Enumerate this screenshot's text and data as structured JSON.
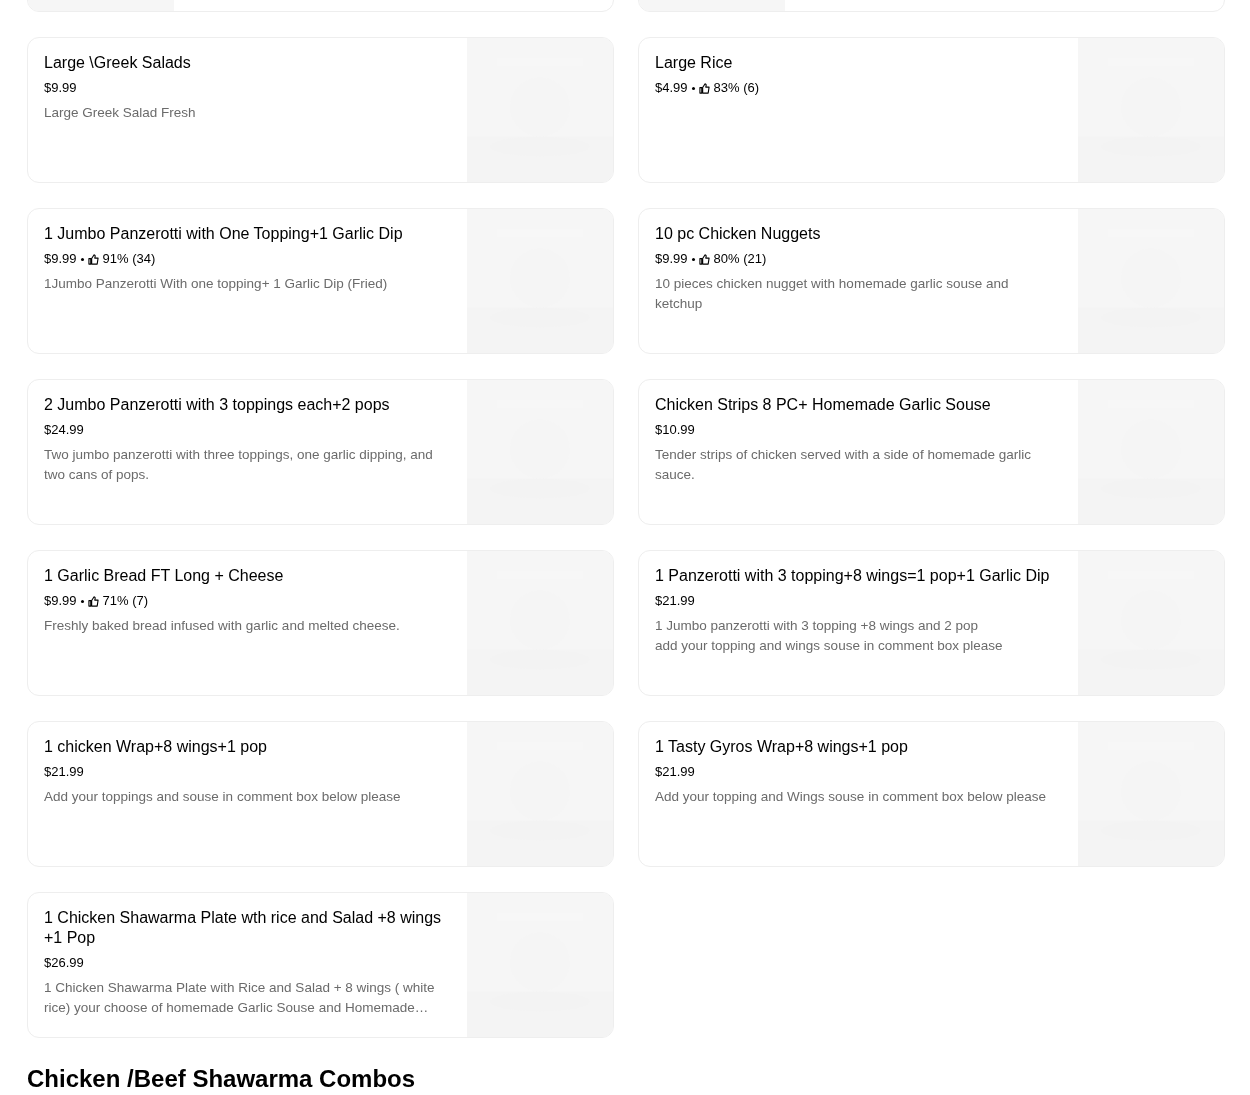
{
  "items": [
    {
      "title": "Large \\Greek Salads",
      "price": "$9.99",
      "description": "Large Greek Salad Fresh"
    },
    {
      "title": "Large Rice",
      "price": "$4.99",
      "rating": "83% (6)"
    },
    {
      "title": "1 Jumbo Panzerotti with One Topping+1 Garlic Dip",
      "price": "$9.99",
      "rating": "91% (34)",
      "description": "1Jumbo Panzerotti With one topping+ 1 Garlic Dip (Fried)"
    },
    {
      "title": "10 pc Chicken Nuggets",
      "price": "$9.99",
      "rating": "80% (21)",
      "description": "10 pieces chicken nugget with homemade garlic souse and ketchup"
    },
    {
      "title": "2 Jumbo Panzerotti with 3 toppings each+2 pops",
      "price": "$24.99",
      "description": "Two jumbo panzerotti with three toppings, one garlic dipping, and two cans of pops."
    },
    {
      "title": "Chicken Strips 8 PC+ Homemade Garlic Souse",
      "price": "$10.99",
      "description": "Tender strips of chicken served with a side of homemade garlic sauce."
    },
    {
      "title": "1 Garlic Bread FT Long + Cheese",
      "price": "$9.99",
      "rating": "71% (7)",
      "description": "Freshly baked bread infused with garlic and melted cheese."
    },
    {
      "title": "1 Panzerotti with 3 topping+8 wings=1 pop+1 Garlic Dip",
      "price": "$21.99",
      "description": "1 Jumbo panzerotti with 3 topping +8 wings and 2 pop\nadd your topping and wings souse in comment box please"
    },
    {
      "title": "1 chicken Wrap+8 wings+1 pop",
      "price": "$21.99",
      "description": "Add your toppings and souse in comment box below please"
    },
    {
      "title": "1 Tasty Gyros Wrap+8 wings+1 pop",
      "price": "$21.99",
      "description": "Add your topping and Wings souse in comment box below please"
    },
    {
      "title": "1 Chicken Shawarma  Plate wth rice and Salad +8 wings +1 Pop",
      "price": "$26.99",
      "description": "1 Chicken Shawarma Plate with Rice and Salad + 8 wings ( white rice) your choose of homemade Garlic Souse and Homemade…"
    }
  ],
  "section_heading": "Chicken /Beef Shawarma Combos"
}
